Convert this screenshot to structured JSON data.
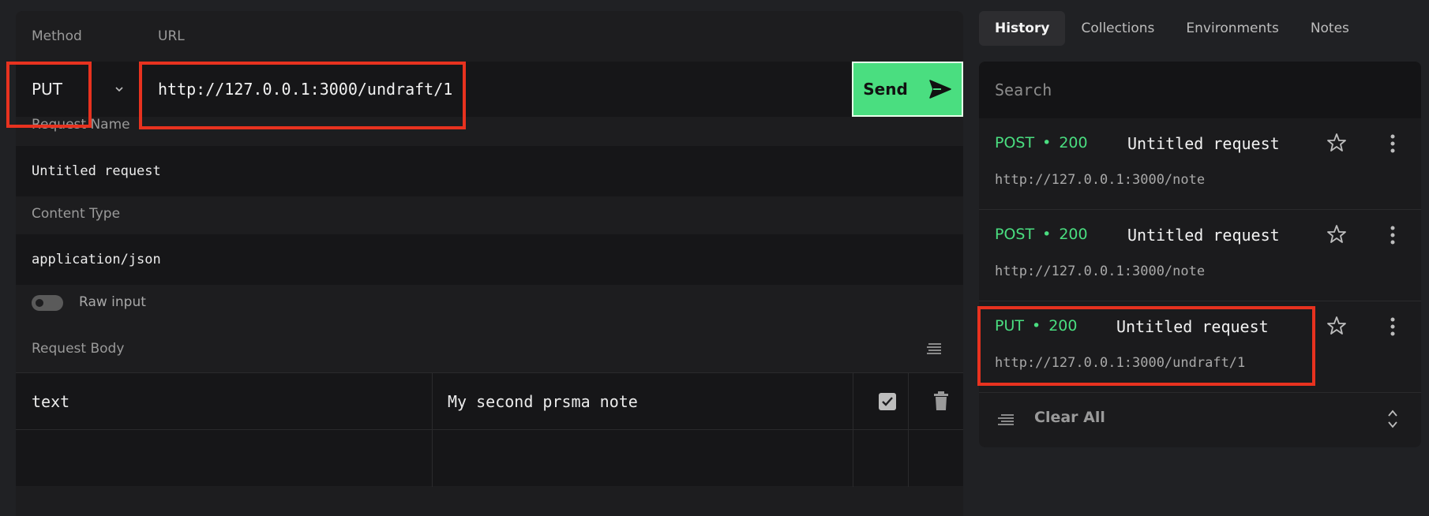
{
  "request": {
    "method_label": "Method",
    "url_label": "URL",
    "method": "PUT",
    "url": "http://127.0.0.1:3000/undraft/1",
    "send_label": "Send",
    "name_label": "Request Name",
    "name": "Untitled request",
    "content_type_label": "Content Type",
    "content_type": "application/json",
    "raw_input_label": "Raw input",
    "body_label": "Request Body",
    "body_rows": [
      {
        "key": "text",
        "value": "My second prsma note",
        "enabled": true
      }
    ]
  },
  "tabs": [
    {
      "label": "History",
      "active": true
    },
    {
      "label": "Collections",
      "active": false
    },
    {
      "label": "Environments",
      "active": false
    },
    {
      "label": "Notes",
      "active": false
    }
  ],
  "history": {
    "search_placeholder": "Search",
    "items": [
      {
        "method": "POST",
        "status": "200",
        "name": "Untitled request",
        "url": "http://127.0.0.1:3000/note"
      },
      {
        "method": "POST",
        "status": "200",
        "name": "Untitled request",
        "url": "http://127.0.0.1:3000/note"
      },
      {
        "method": "PUT",
        "status": "200",
        "name": "Untitled request",
        "url": "http://127.0.0.1:3000/undraft/1"
      }
    ],
    "clear_label": "Clear All"
  },
  "colors": {
    "accent": "#4ade80",
    "highlight": "#e8321f"
  }
}
